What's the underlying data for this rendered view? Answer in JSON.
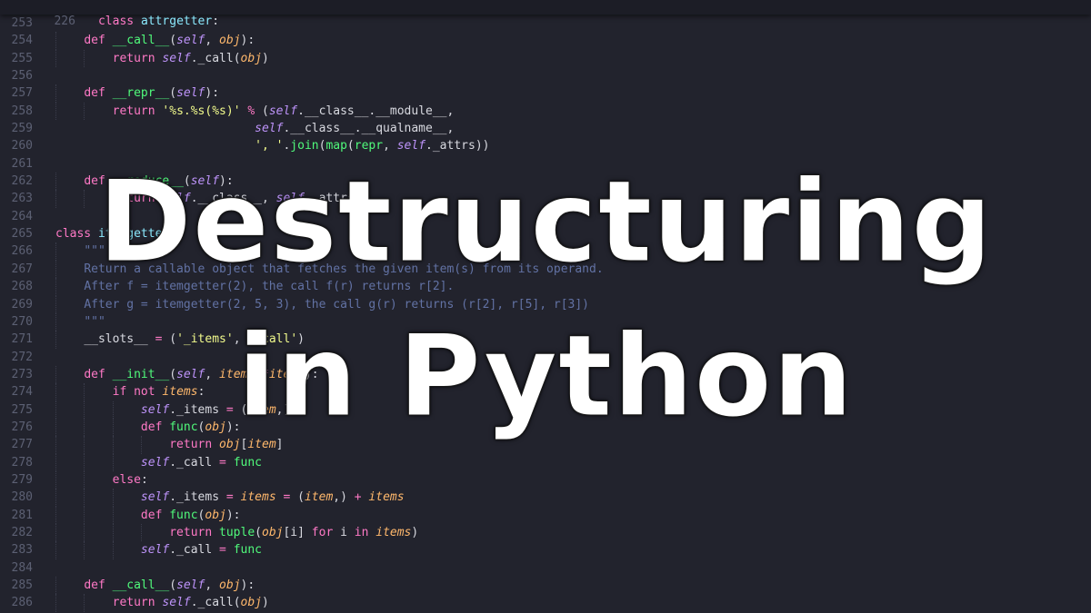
{
  "title": {
    "line1": "Destructuring",
    "line2": "in Python"
  },
  "editor": {
    "sticky_header": {
      "number": "226",
      "tokens": [
        {
          "t": "class",
          "c": "kw"
        },
        {
          "t": " "
        },
        {
          "t": "attrgetter",
          "c": "cls"
        },
        {
          "t": ":"
        }
      ]
    },
    "lines": [
      {
        "n": "253",
        "indent": 0,
        "tokens": []
      },
      {
        "n": "254",
        "indent": 1,
        "tokens": [
          {
            "t": "def",
            "c": "kw"
          },
          {
            "t": " "
          },
          {
            "t": "__call__",
            "c": "fn"
          },
          {
            "t": "("
          },
          {
            "t": "self",
            "c": "slf"
          },
          {
            "t": ", "
          },
          {
            "t": "obj",
            "c": "prm"
          },
          {
            "t": "):"
          }
        ]
      },
      {
        "n": "255",
        "indent": 2,
        "tokens": [
          {
            "t": "return",
            "c": "kw"
          },
          {
            "t": " "
          },
          {
            "t": "self",
            "c": "slf"
          },
          {
            "t": "._call("
          },
          {
            "t": "obj",
            "c": "prm"
          },
          {
            "t": ")"
          }
        ]
      },
      {
        "n": "256",
        "indent": 0,
        "tokens": []
      },
      {
        "n": "257",
        "indent": 1,
        "tokens": [
          {
            "t": "def",
            "c": "kw"
          },
          {
            "t": " "
          },
          {
            "t": "__repr__",
            "c": "fn"
          },
          {
            "t": "("
          },
          {
            "t": "self",
            "c": "slf"
          },
          {
            "t": "):"
          }
        ]
      },
      {
        "n": "258",
        "indent": 2,
        "tokens": [
          {
            "t": "return",
            "c": "kw"
          },
          {
            "t": " "
          },
          {
            "t": "'%s.%s(%s)'",
            "c": "str"
          },
          {
            "t": " "
          },
          {
            "t": "%",
            "c": "op"
          },
          {
            "t": " ("
          },
          {
            "t": "self",
            "c": "slf"
          },
          {
            "t": ".__class__.__module__,"
          }
        ]
      },
      {
        "n": "259",
        "indent": 0,
        "tokens": [
          {
            "t": "                            "
          },
          {
            "t": "self",
            "c": "slf"
          },
          {
            "t": ".__class__.__qualname__,"
          }
        ]
      },
      {
        "n": "260",
        "indent": 0,
        "tokens": [
          {
            "t": "                            "
          },
          {
            "t": "', '",
            "c": "str"
          },
          {
            "t": "."
          },
          {
            "t": "join",
            "c": "fn"
          },
          {
            "t": "("
          },
          {
            "t": "map",
            "c": "fn"
          },
          {
            "t": "("
          },
          {
            "t": "repr",
            "c": "fn"
          },
          {
            "t": ", "
          },
          {
            "t": "self",
            "c": "slf"
          },
          {
            "t": "._attrs))"
          }
        ]
      },
      {
        "n": "261",
        "indent": 0,
        "tokens": []
      },
      {
        "n": "262",
        "indent": 1,
        "tokens": [
          {
            "t": "def",
            "c": "kw"
          },
          {
            "t": " "
          },
          {
            "t": "__reduce__",
            "c": "fn"
          },
          {
            "t": "("
          },
          {
            "t": "self",
            "c": "slf"
          },
          {
            "t": "):"
          }
        ]
      },
      {
        "n": "263",
        "indent": 2,
        "tokens": [
          {
            "t": "return",
            "c": "kw"
          },
          {
            "t": " "
          },
          {
            "t": "self",
            "c": "slf"
          },
          {
            "t": ".__class__, "
          },
          {
            "t": "self",
            "c": "slf"
          },
          {
            "t": "._attrs"
          }
        ]
      },
      {
        "n": "264",
        "indent": 0,
        "tokens": []
      },
      {
        "n": "265",
        "indent": 0,
        "tokens": [
          {
            "t": "class",
            "c": "kw"
          },
          {
            "t": " "
          },
          {
            "t": "itemgetter",
            "c": "cls"
          },
          {
            "t": ":"
          }
        ]
      },
      {
        "n": "266",
        "indent": 1,
        "tokens": [
          {
            "t": "\"\"\"",
            "c": "cmt"
          }
        ]
      },
      {
        "n": "267",
        "indent": 1,
        "tokens": [
          {
            "t": "Return a callable object that fetches the given item(s) from its operand.",
            "c": "cmt"
          }
        ]
      },
      {
        "n": "268",
        "indent": 1,
        "tokens": [
          {
            "t": "After f = itemgetter(2), the call f(r) returns r[2].",
            "c": "cmt"
          }
        ]
      },
      {
        "n": "269",
        "indent": 1,
        "tokens": [
          {
            "t": "After g = itemgetter(2, 5, 3), the call g(r) returns (r[2], r[5], r[3])",
            "c": "cmt"
          }
        ]
      },
      {
        "n": "270",
        "indent": 1,
        "tokens": [
          {
            "t": "\"\"\"",
            "c": "cmt"
          }
        ]
      },
      {
        "n": "271",
        "indent": 1,
        "tokens": [
          {
            "t": "__slots__ "
          },
          {
            "t": "=",
            "c": "op"
          },
          {
            "t": " ("
          },
          {
            "t": "'_items'",
            "c": "str"
          },
          {
            "t": ", "
          },
          {
            "t": "'_call'",
            "c": "str"
          },
          {
            "t": ")"
          }
        ]
      },
      {
        "n": "272",
        "indent": 0,
        "tokens": []
      },
      {
        "n": "273",
        "indent": 1,
        "tokens": [
          {
            "t": "def",
            "c": "kw"
          },
          {
            "t": " "
          },
          {
            "t": "__init__",
            "c": "fn"
          },
          {
            "t": "("
          },
          {
            "t": "self",
            "c": "slf"
          },
          {
            "t": ", "
          },
          {
            "t": "item",
            "c": "prm"
          },
          {
            "t": ", "
          },
          {
            "t": "*",
            "c": "op"
          },
          {
            "t": "items",
            "c": "prm"
          },
          {
            "t": "):"
          }
        ]
      },
      {
        "n": "274",
        "indent": 2,
        "tokens": [
          {
            "t": "if",
            "c": "kw"
          },
          {
            "t": " "
          },
          {
            "t": "not",
            "c": "kw"
          },
          {
            "t": " "
          },
          {
            "t": "items",
            "c": "prm"
          },
          {
            "t": ":"
          }
        ]
      },
      {
        "n": "275",
        "indent": 3,
        "tokens": [
          {
            "t": "self",
            "c": "slf"
          },
          {
            "t": "._items "
          },
          {
            "t": "=",
            "c": "op"
          },
          {
            "t": " ("
          },
          {
            "t": "item",
            "c": "prm"
          },
          {
            "t": ",)"
          }
        ]
      },
      {
        "n": "276",
        "indent": 3,
        "tokens": [
          {
            "t": "def",
            "c": "kw"
          },
          {
            "t": " "
          },
          {
            "t": "func",
            "c": "fn"
          },
          {
            "t": "("
          },
          {
            "t": "obj",
            "c": "prm"
          },
          {
            "t": "):"
          }
        ]
      },
      {
        "n": "277",
        "indent": 4,
        "tokens": [
          {
            "t": "return",
            "c": "kw"
          },
          {
            "t": " "
          },
          {
            "t": "obj",
            "c": "prm"
          },
          {
            "t": "["
          },
          {
            "t": "item",
            "c": "prm"
          },
          {
            "t": "]"
          }
        ]
      },
      {
        "n": "278",
        "indent": 3,
        "tokens": [
          {
            "t": "self",
            "c": "slf"
          },
          {
            "t": "._call "
          },
          {
            "t": "=",
            "c": "op"
          },
          {
            "t": " "
          },
          {
            "t": "func",
            "c": "fn"
          }
        ]
      },
      {
        "n": "279",
        "indent": 2,
        "tokens": [
          {
            "t": "else",
            "c": "kw"
          },
          {
            "t": ":"
          }
        ]
      },
      {
        "n": "280",
        "indent": 3,
        "tokens": [
          {
            "t": "self",
            "c": "slf"
          },
          {
            "t": "._items "
          },
          {
            "t": "=",
            "c": "op"
          },
          {
            "t": " "
          },
          {
            "t": "items",
            "c": "prm"
          },
          {
            "t": " "
          },
          {
            "t": "=",
            "c": "op"
          },
          {
            "t": " ("
          },
          {
            "t": "item",
            "c": "prm"
          },
          {
            "t": ",) "
          },
          {
            "t": "+",
            "c": "op"
          },
          {
            "t": " "
          },
          {
            "t": "items",
            "c": "prm"
          }
        ]
      },
      {
        "n": "281",
        "indent": 3,
        "tokens": [
          {
            "t": "def",
            "c": "kw"
          },
          {
            "t": " "
          },
          {
            "t": "func",
            "c": "fn"
          },
          {
            "t": "("
          },
          {
            "t": "obj",
            "c": "prm"
          },
          {
            "t": "):"
          }
        ]
      },
      {
        "n": "282",
        "indent": 4,
        "tokens": [
          {
            "t": "return",
            "c": "kw"
          },
          {
            "t": " "
          },
          {
            "t": "tuple",
            "c": "fn"
          },
          {
            "t": "("
          },
          {
            "t": "obj",
            "c": "prm"
          },
          {
            "t": "[i] "
          },
          {
            "t": "for",
            "c": "kw"
          },
          {
            "t": " i "
          },
          {
            "t": "in",
            "c": "kw"
          },
          {
            "t": " "
          },
          {
            "t": "items",
            "c": "prm"
          },
          {
            "t": ")"
          }
        ]
      },
      {
        "n": "283",
        "indent": 3,
        "tokens": [
          {
            "t": "self",
            "c": "slf"
          },
          {
            "t": "._call "
          },
          {
            "t": "=",
            "c": "op"
          },
          {
            "t": " "
          },
          {
            "t": "func",
            "c": "fn"
          }
        ]
      },
      {
        "n": "284",
        "indent": 0,
        "tokens": []
      },
      {
        "n": "285",
        "indent": 1,
        "tokens": [
          {
            "t": "def",
            "c": "kw"
          },
          {
            "t": " "
          },
          {
            "t": "__call__",
            "c": "fn"
          },
          {
            "t": "("
          },
          {
            "t": "self",
            "c": "slf"
          },
          {
            "t": ", "
          },
          {
            "t": "obj",
            "c": "prm"
          },
          {
            "t": "):"
          }
        ]
      },
      {
        "n": "286",
        "indent": 2,
        "tokens": [
          {
            "t": "return",
            "c": "kw"
          },
          {
            "t": " "
          },
          {
            "t": "self",
            "c": "slf"
          },
          {
            "t": "._call("
          },
          {
            "t": "obj",
            "c": "prm"
          },
          {
            "t": ")"
          }
        ]
      }
    ]
  }
}
